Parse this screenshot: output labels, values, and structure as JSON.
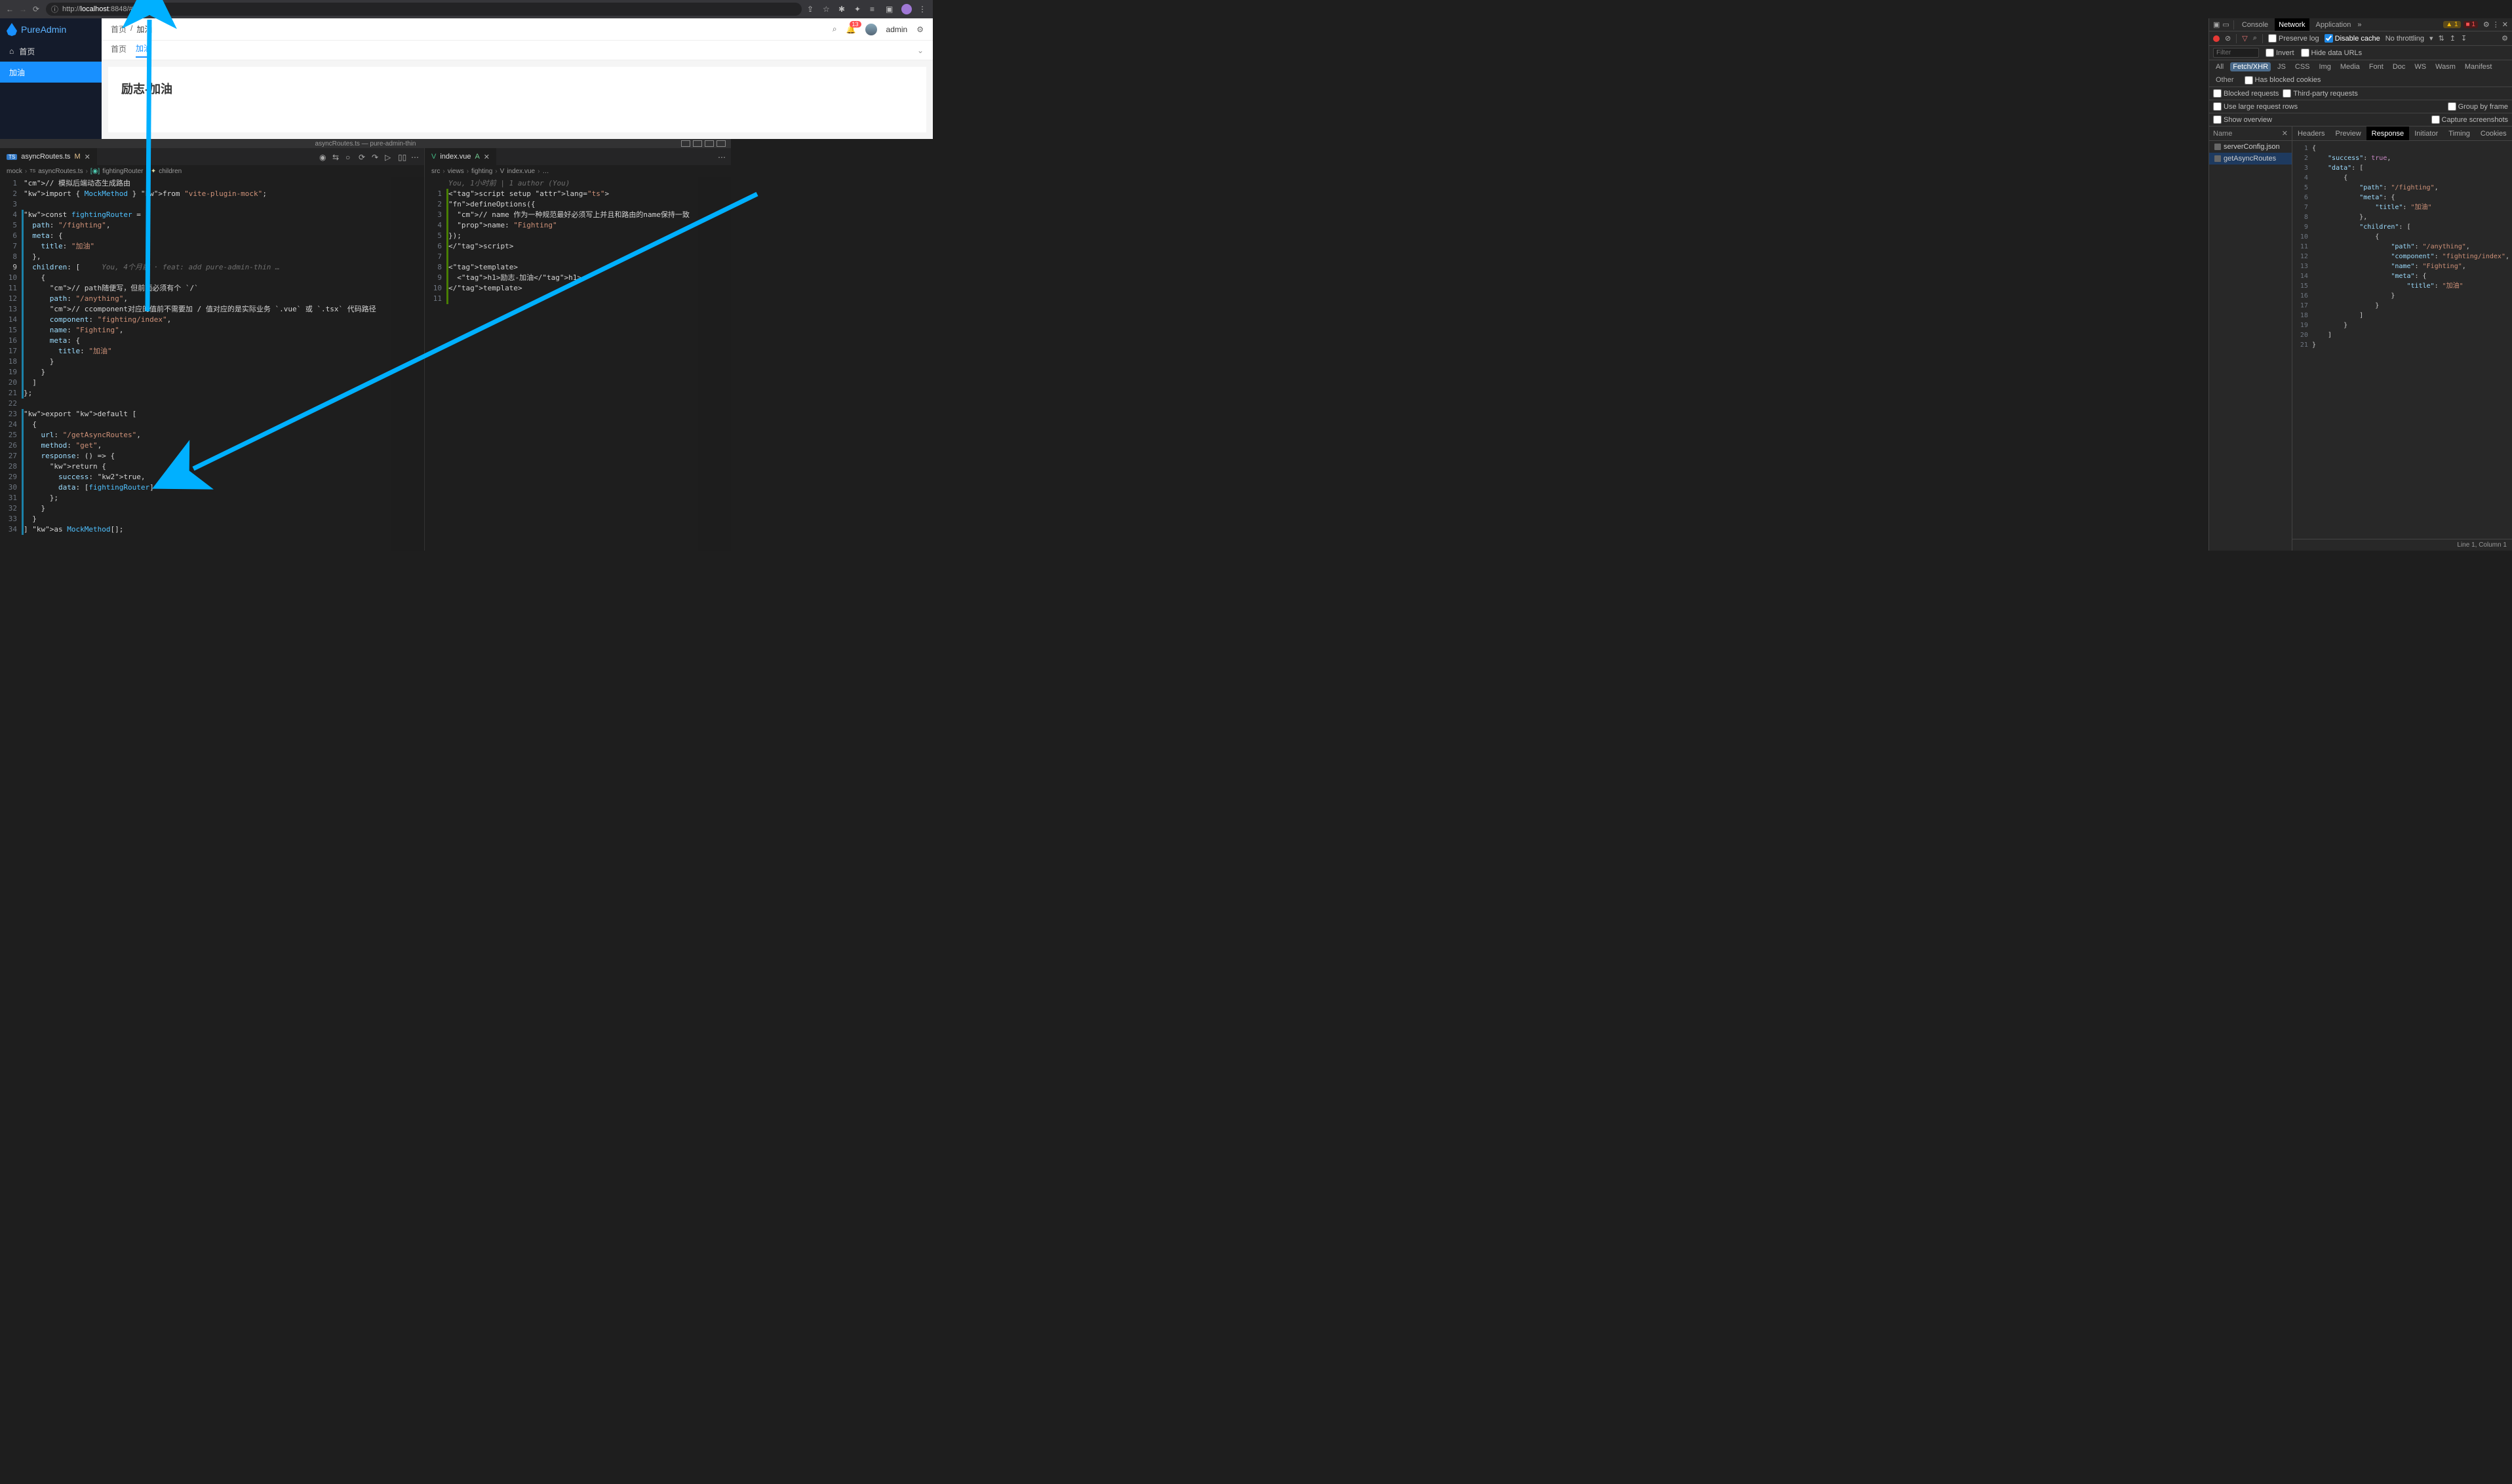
{
  "browser": {
    "url_prefix": "http://",
    "url_host": "localhost",
    "url_port": ":8848",
    "url_path": "/#/anything"
  },
  "admin_app": {
    "logo_text": "PureAdmin",
    "username": "admin",
    "notif_count": "13",
    "sidebar": [
      {
        "icon": "home",
        "label": "首页"
      },
      {
        "icon": "",
        "label": "加油"
      }
    ],
    "breadcrumb": [
      "首页",
      "加油"
    ],
    "tabs": [
      "首页",
      "加油"
    ],
    "active_tab": "加油",
    "page_heading": "励志-加油"
  },
  "devtools": {
    "main_tabs": [
      "Console",
      "Network",
      "Application"
    ],
    "active_main_tab": "Network",
    "warn_count": "1",
    "err_count": "1",
    "toolbar": {
      "preserve_log": "Preserve log",
      "disable_cache": "Disable cache",
      "throttling": "No throttling"
    },
    "filter_placeholder": "Filter",
    "invert": "Invert",
    "hide_data_urls": "Hide data URLs",
    "pills": [
      "All",
      "Fetch/XHR",
      "JS",
      "CSS",
      "Img",
      "Media",
      "Font",
      "Doc",
      "WS",
      "Wasm",
      "Manifest",
      "Other"
    ],
    "active_pill": "Fetch/XHR",
    "has_blocked_cookies": "Has blocked cookies",
    "blocked_requests": "Blocked requests",
    "third_party": "Third-party requests",
    "use_large_rows": "Use large request rows",
    "group_by_frame": "Group by frame",
    "show_overview": "Show overview",
    "capture_screenshots": "Capture screenshots",
    "name_col": "Name",
    "requests": [
      "serverConfig.json",
      "getAsyncRoutes"
    ],
    "active_request": "getAsyncRoutes",
    "resp_tabs": [
      "Headers",
      "Preview",
      "Response",
      "Initiator",
      "Timing",
      "Cookies"
    ],
    "active_resp_tab": "Response",
    "footer": "Line 1, Column 1",
    "response_json": {
      "success": true,
      "data": [
        {
          "path": "/fighting",
          "meta": {
            "title": "加油"
          },
          "children": [
            {
              "path": "/anything",
              "component": "fighting/index",
              "name": "Fighting",
              "meta": {
                "title": "加油"
              }
            }
          ]
        }
      ]
    }
  },
  "vscode": {
    "title": "asyncRoutes.ts — pure-admin-thin",
    "left": {
      "tab": "asyncRoutes.ts",
      "tab_status": "M",
      "breadcrumb": [
        "mock",
        "asyncRoutes.ts",
        "fightingRouter",
        "children"
      ],
      "blame": "You, 4个月前 · feat: add pure-admin-thin …",
      "lines": [
        "// 模拟后端动态生成路由",
        "import { MockMethod } from \"vite-plugin-mock\";",
        "",
        "const fightingRouter = {",
        "  path: \"/fighting\",",
        "  meta: {",
        "    title: \"加油\"",
        "  },",
        "  children: [",
        "    {",
        "      // path随便写，但前面必须有个 `/`",
        "      path: \"/anything\",",
        "      // ccomponent对应的值前不需要加 / 值对应的是实际业务 `.vue` 或 `.tsx` 代码路径",
        "      component: \"fighting/index\",",
        "      name: \"Fighting\",",
        "      meta: {",
        "        title: \"加油\"",
        "      }",
        "    }",
        "  ]",
        "};",
        "",
        "export default [",
        "  {",
        "    url: \"/getAsyncRoutes\",",
        "    method: \"get\",",
        "    response: () => {",
        "      return {",
        "        success: true,",
        "        data: [fightingRouter]",
        "      };",
        "    }",
        "  }",
        "] as MockMethod[];"
      ]
    },
    "right": {
      "tab": "index.vue",
      "tab_status": "A",
      "breadcrumb": [
        "src",
        "views",
        "fighting",
        "index.vue",
        "…"
      ],
      "blame": "You, 1小时前 | 1 author (You)",
      "lines": [
        "<script setup lang=\"ts\">",
        "defineOptions({",
        "  // name 作为一种规范最好必须写上并且和路由的name保持一致",
        "  name: \"Fighting\"",
        "});",
        "</script>",
        "",
        "<template>",
        "  <h1>励志-加油</h1>",
        "</template>",
        ""
      ]
    }
  }
}
